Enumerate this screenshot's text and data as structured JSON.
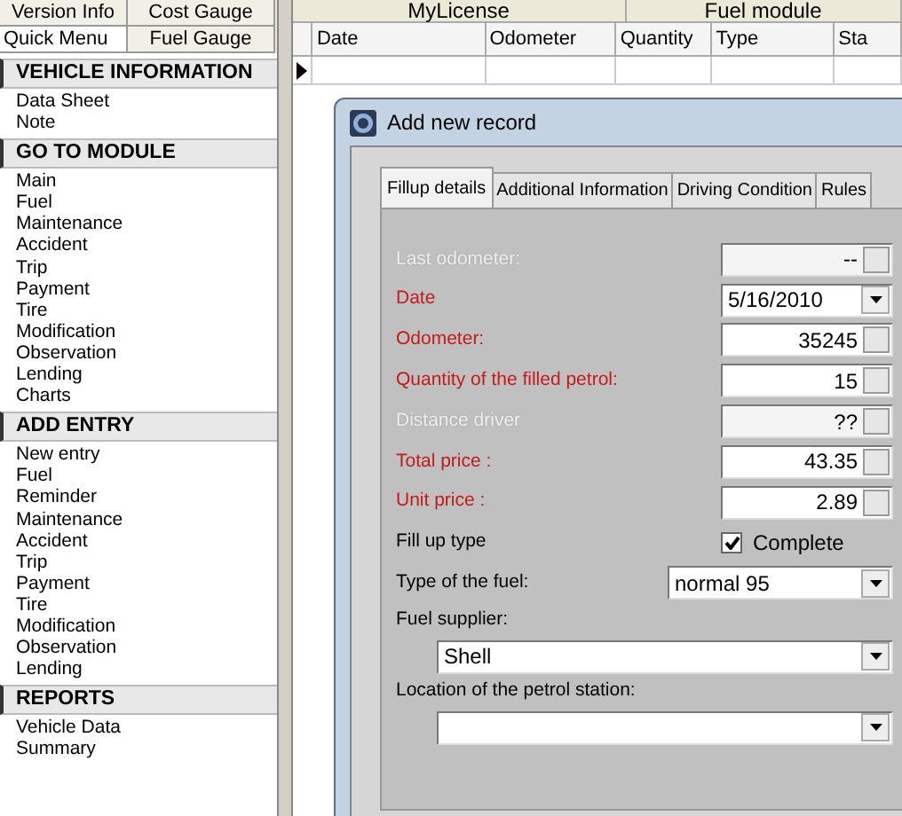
{
  "left_tabs": [
    {
      "label": "Version Info",
      "selected": false
    },
    {
      "label": "Cost Gauge",
      "selected": false
    },
    {
      "label": "Quick Menu",
      "selected": true
    },
    {
      "label": "Fuel Gauge",
      "selected": false
    }
  ],
  "menu_sections": [
    {
      "title": "VEHICLE INFORMATION",
      "items": [
        "Data Sheet",
        "Note"
      ]
    },
    {
      "title": "GO TO MODULE",
      "items": [
        "Main",
        "Fuel",
        "Maintenance",
        "Accident",
        "Trip",
        "Payment",
        "Tire",
        "Modification",
        "Observation",
        "Lending",
        "Charts"
      ]
    },
    {
      "title": "ADD ENTRY",
      "items": [
        "New entry",
        "Fuel",
        "Reminder",
        "Maintenance",
        "Accident",
        "Trip",
        "Payment",
        "Tire",
        "Modification",
        "Observation",
        "Lending"
      ]
    },
    {
      "title": "REPORTS",
      "items": [
        "Vehicle Data",
        "Summary"
      ]
    }
  ],
  "grid": {
    "bands": [
      "MyLicense",
      "Fuel module"
    ],
    "columns": [
      "Date",
      "Odometer",
      "Quantity",
      "Type",
      "Sta"
    ]
  },
  "dialog": {
    "title": "Add new record",
    "tabs": [
      {
        "label": "Fillup details",
        "selected": true
      },
      {
        "label": "Additional Information",
        "selected": false
      },
      {
        "label": "Driving Condition",
        "selected": false
      },
      {
        "label": "Rules",
        "selected": false
      }
    ],
    "fields": [
      {
        "kind": "number",
        "label": "Last odometer:",
        "disabled": true,
        "required": false,
        "value": "--"
      },
      {
        "kind": "date",
        "label": "Date",
        "disabled": false,
        "required": true,
        "value": "5/16/2010"
      },
      {
        "kind": "number",
        "label": "Odometer:",
        "disabled": false,
        "required": true,
        "value": "35245"
      },
      {
        "kind": "number",
        "label": "Quantity of the filled petrol:",
        "disabled": false,
        "required": true,
        "value": "15"
      },
      {
        "kind": "number",
        "label": "Distance driver",
        "disabled": true,
        "required": false,
        "value": "??"
      },
      {
        "kind": "number",
        "label": "Total price :",
        "disabled": false,
        "required": true,
        "value": "43.35"
      },
      {
        "kind": "number",
        "label": "Unit price :",
        "disabled": false,
        "required": true,
        "value": "2.89"
      },
      {
        "kind": "checkbox",
        "label": "Fill up type",
        "disabled": false,
        "required": false,
        "option": "Complete",
        "checked": true
      },
      {
        "kind": "combo",
        "label": "Type of the fuel:",
        "disabled": false,
        "required": false,
        "value": "normal 95"
      },
      {
        "kind": "wide_combo",
        "label": "Fuel supplier:",
        "disabled": false,
        "required": false,
        "value": "Shell"
      },
      {
        "kind": "wide_combo",
        "label": "Location of the petrol station:",
        "disabled": false,
        "required": false
      }
    ]
  }
}
